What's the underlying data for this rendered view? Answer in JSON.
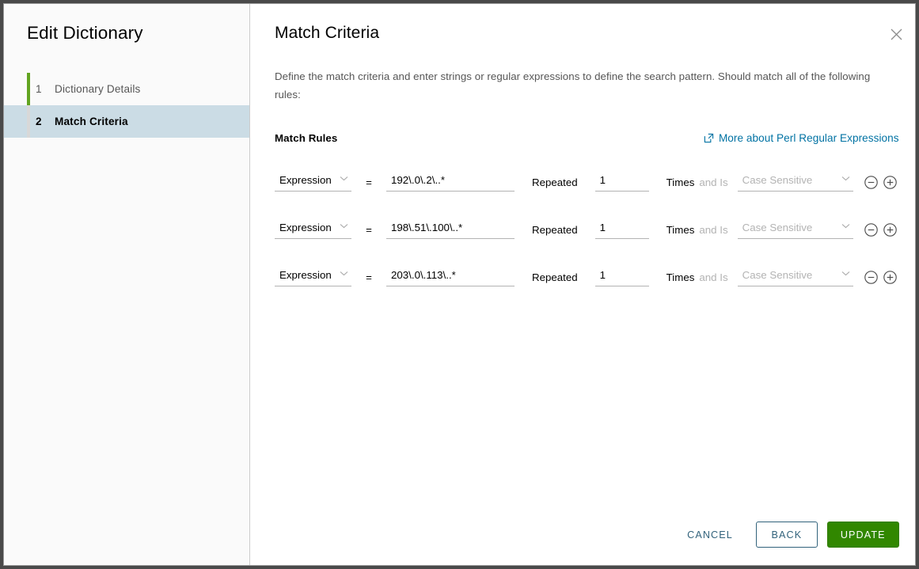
{
  "window": {
    "accent_green": "#62a420",
    "accent_blue": "#0072a3",
    "active_step_bg": "#cbdce5"
  },
  "wizard": {
    "title": "Edit Dictionary",
    "steps": [
      {
        "number": "1",
        "label": "Dictionary Details",
        "state": "done"
      },
      {
        "number": "2",
        "label": "Match Criteria",
        "state": "active"
      }
    ]
  },
  "content": {
    "title": "Match Criteria",
    "close_icon": "close-icon",
    "description": "Define the match criteria and enter strings or regular expressions to define the search pattern. Should match all of the following rules:",
    "rules_label": "Match Rules",
    "perl_link": {
      "icon": "external-link-icon",
      "label": "More about Perl Regular Expressions"
    },
    "labels": {
      "equals": "=",
      "repeated": "Repeated",
      "times": "Times",
      "and_is": "and Is"
    },
    "case_placeholder": "Case Sensitive",
    "remove_icon": "circle-minus-icon",
    "add_icon": "circle-plus-icon",
    "rules": [
      {
        "operator": "Expression",
        "expression": "192\\.0\\.2\\..*",
        "repeat": "1",
        "case": ""
      },
      {
        "operator": "Expression",
        "expression": "198\\.51\\.100\\..*",
        "repeat": "1",
        "case": ""
      },
      {
        "operator": "Expression",
        "expression": "203\\.0\\.113\\..*",
        "repeat": "1",
        "case": ""
      }
    ]
  },
  "footer": {
    "cancel_label": "Cancel",
    "back_label": "Back",
    "update_label": "Update"
  }
}
